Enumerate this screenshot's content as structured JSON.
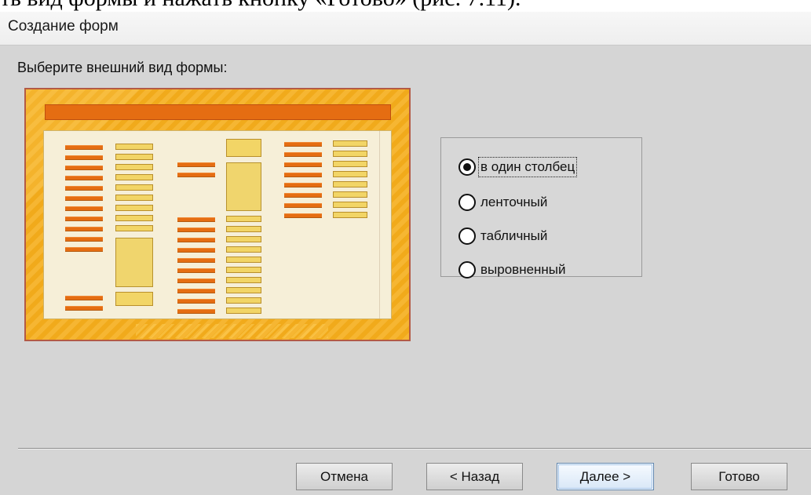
{
  "document": {
    "top_text": "ть вид формы и нажать кнопку «Готово» (рис. 7.11)."
  },
  "dialog": {
    "title": "Создание форм",
    "prompt": "Выберите внешний вид формы:",
    "preview": {
      "description_icon": "form-layout-preview-icon"
    },
    "layout_options": [
      {
        "label": "в один столбец",
        "selected": true
      },
      {
        "label": "ленточный",
        "selected": false
      },
      {
        "label": "табличный",
        "selected": false
      },
      {
        "label": "выровненный",
        "selected": false
      }
    ],
    "buttons": {
      "cancel": "Отмена",
      "back": "< Назад",
      "next": "Далее >",
      "finish": "Готово"
    }
  },
  "colors": {
    "dialog_bg": "#d5d5d5",
    "preview_orange": "#f1aa1b",
    "preview_accent": "#e56d12",
    "preview_field": "#f2d566",
    "primary_button_border": "#5f86b0"
  }
}
